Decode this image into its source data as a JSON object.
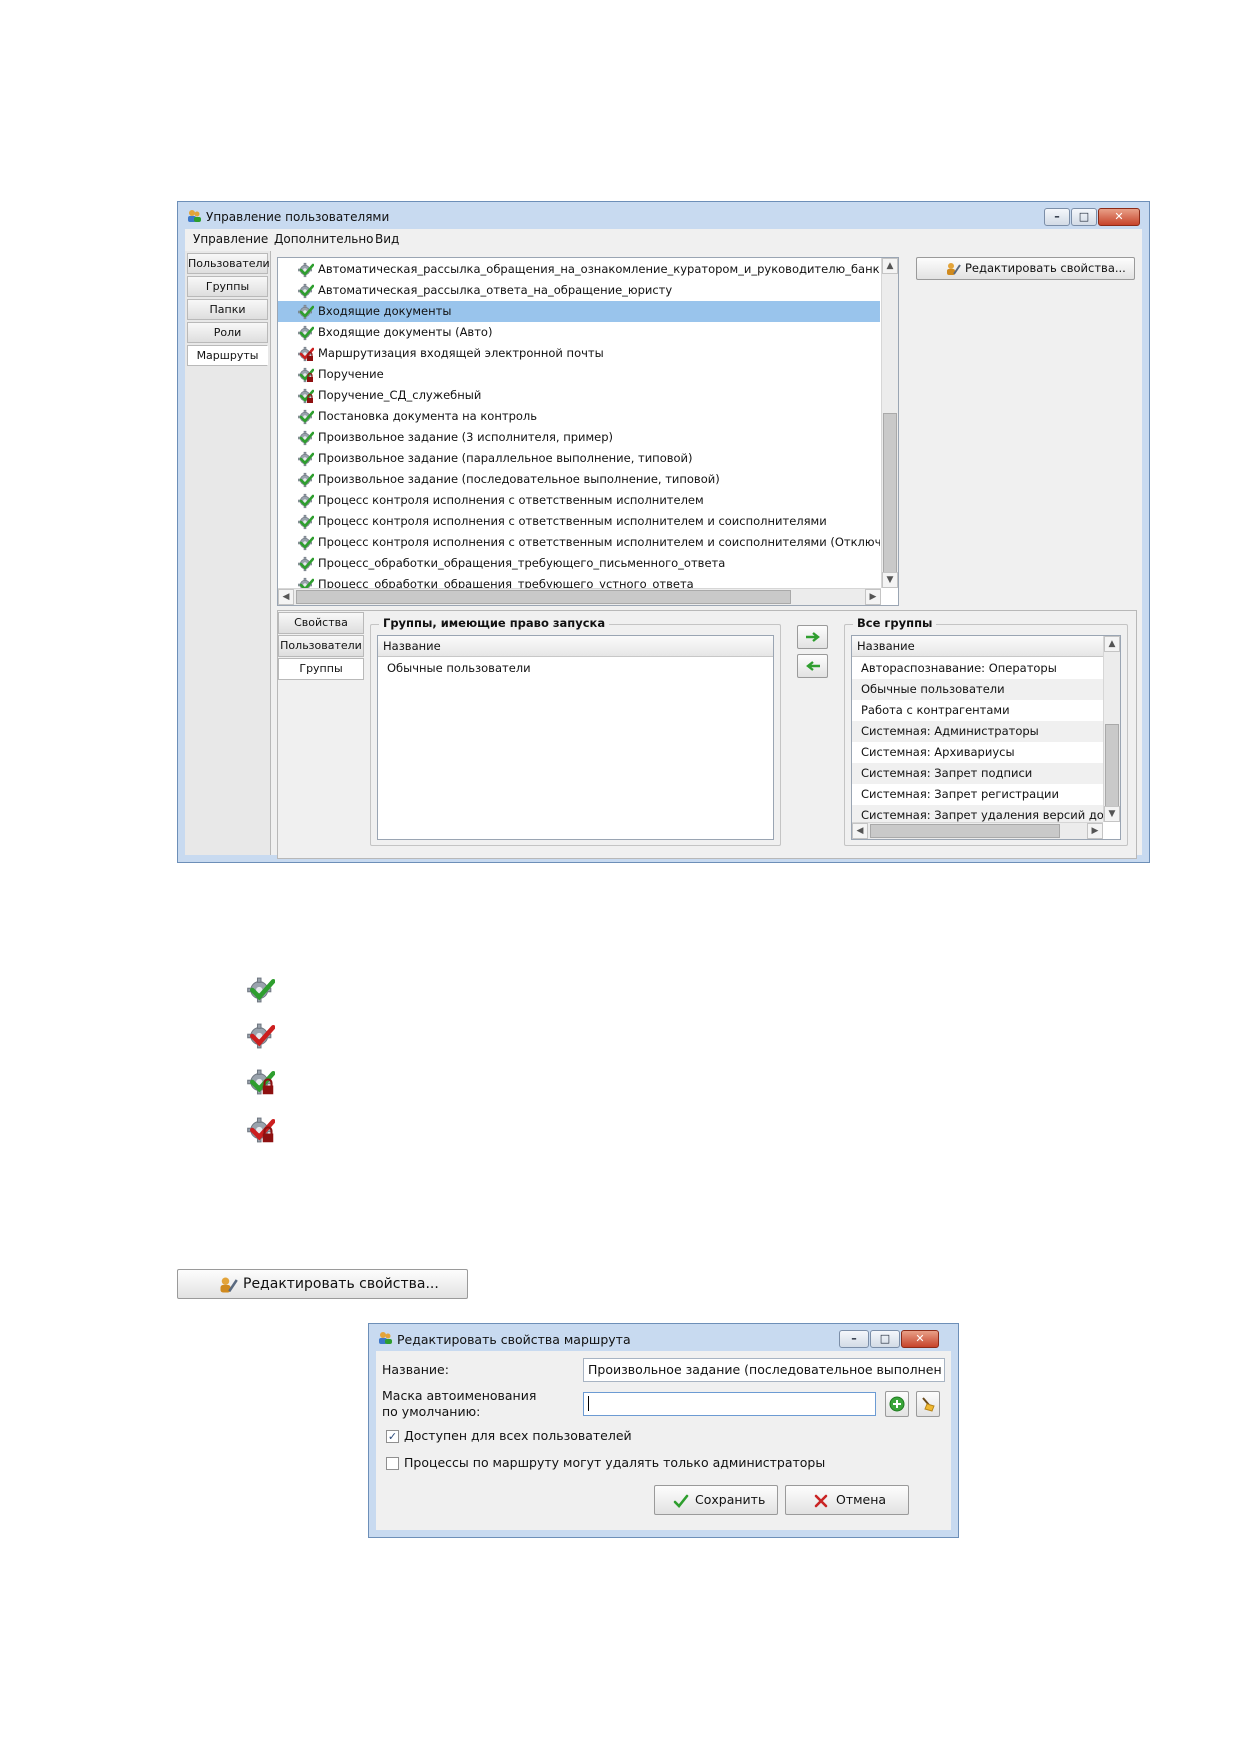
{
  "main_window": {
    "title": "Управление пользователями",
    "menu": [
      "Управление",
      "Дополнительно",
      "Вид"
    ],
    "left_tabs": [
      "Пользователи",
      "Группы",
      "Папки",
      "Роли",
      "Маршруты"
    ],
    "active_left_tab": "Маршруты",
    "routes": [
      {
        "label": "Автоматическая_рассылка_обращения_на_ознакомление_куратором_и_руководителю_банка",
        "icon": "gear-green-check-icon"
      },
      {
        "label": "Автоматическая_рассылка_ответа_на_обращение_юристу",
        "icon": "gear-green-check-icon"
      },
      {
        "label": "Входящие документы",
        "icon": "gear-green-check-icon",
        "selected": true
      },
      {
        "label": "Входящие документы (Авто)",
        "icon": "gear-green-check-icon"
      },
      {
        "label": "Маршрутизация входящей электронной почты",
        "icon": "gear-red-check-lock-icon"
      },
      {
        "label": "Поручение",
        "icon": "gear-green-check-lock-icon"
      },
      {
        "label": "Поручение_СД_служебный",
        "icon": "gear-green-check-lock-icon"
      },
      {
        "label": "Постановка документа на контроль",
        "icon": "gear-green-check-icon"
      },
      {
        "label": "Произвольное задание (3 исполнителя, пример)",
        "icon": "gear-green-check-icon"
      },
      {
        "label": "Произвольное задание (параллельное выполнение, типовой)",
        "icon": "gear-green-check-icon"
      },
      {
        "label": "Произвольное задание (последовательное выполнение, типовой)",
        "icon": "gear-green-check-icon"
      },
      {
        "label": "Процесс контроля исполнения с ответственным исполнителем",
        "icon": "gear-green-check-icon"
      },
      {
        "label": "Процесс контроля исполнения с ответственным исполнителем и соисполнителями",
        "icon": "gear-green-check-icon"
      },
      {
        "label": "Процесс контроля исполнения с ответственным исполнителем и соисполнителями (Отключен при обн",
        "icon": "gear-green-check-icon"
      },
      {
        "label": "Процесс_обработки_обращения_требующего_письменного_ответа",
        "icon": "gear-green-check-icon"
      },
      {
        "label": "Процесс_обработки_обращения_требующего_устного_ответа",
        "icon": "gear-green-check-icon"
      }
    ],
    "edit_button": "Редактировать свойства...",
    "inner_tabs": [
      "Свойства",
      "Пользователи",
      "Группы"
    ],
    "active_inner_tab": "Группы",
    "allowed_groups": {
      "title": "Группы, имеющие право запуска",
      "column": "Название",
      "rows": [
        "Обычные пользователи"
      ]
    },
    "all_groups": {
      "title": "Все группы",
      "column": "Название",
      "rows": [
        "Автораспознавание: Операторы",
        "Обычные пользователи",
        "Работа с контрагентами",
        "Системная: Администраторы",
        "Системная: Архивариусы",
        "Системная: Запрет подписи",
        "Системная: Запрет регистрации",
        "Системная: Запрет удаления версий докумен"
      ]
    }
  },
  "legend_icons": [
    "gear-green-check-icon",
    "gear-red-check-icon",
    "gear-green-check-lock-icon",
    "gear-red-check-lock-icon"
  ],
  "standalone_button": "Редактировать свойства...",
  "dialog": {
    "title": "Редактировать свойства маршрута",
    "name_label": "Название:",
    "name_value": "Произвольное задание (последовательное выполнен",
    "mask_label_line1": "Маска автоименования",
    "mask_label_line2": "по умолчанию:",
    "mask_value": "",
    "checkbox_all_users": {
      "label": "Доступен для всех пользователей",
      "checked": true
    },
    "checkbox_admin_delete": {
      "label": "Процессы по маршруту могут удалять только администраторы",
      "checked": false
    },
    "save_button": "Сохранить",
    "cancel_button": "Отмена"
  },
  "colors": {
    "selection": "#99c4ec",
    "frame": "#c8daf0",
    "check_green": "#2e9e2e",
    "check_red": "#cc1f1f"
  }
}
